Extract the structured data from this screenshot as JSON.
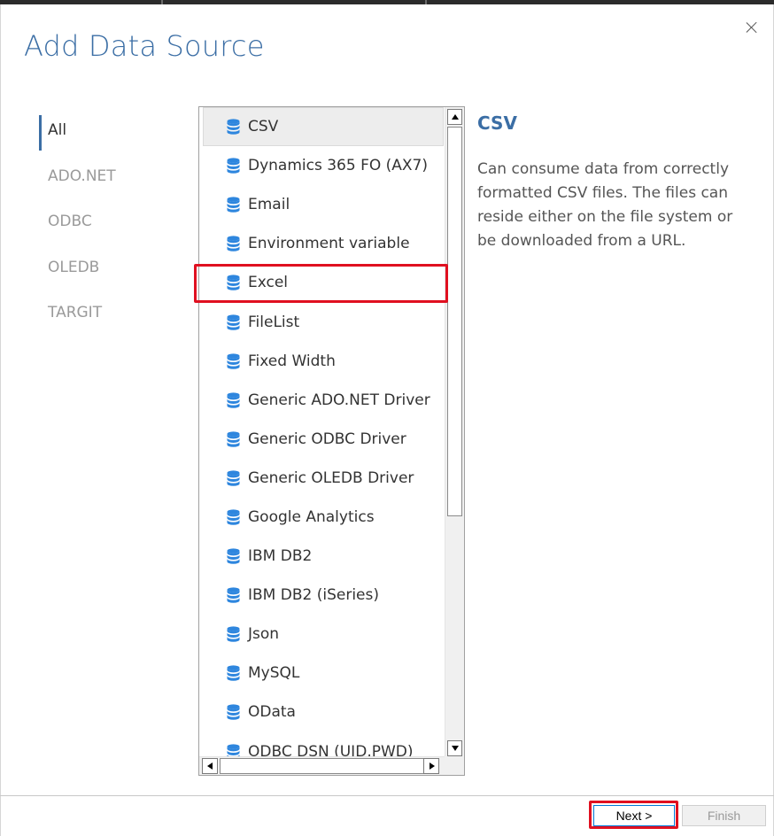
{
  "dialog": {
    "title": "Add Data Source",
    "close_icon": "close-icon"
  },
  "categories": [
    {
      "label": "All",
      "active": true
    },
    {
      "label": "ADO.NET",
      "active": false
    },
    {
      "label": "ODBC",
      "active": false
    },
    {
      "label": "OLEDB",
      "active": false
    },
    {
      "label": "TARGIT",
      "active": false
    }
  ],
  "sources": {
    "icon": "database-icon",
    "items": [
      {
        "label": "CSV",
        "selected": true
      },
      {
        "label": "Dynamics 365 FO (AX7)"
      },
      {
        "label": "Email"
      },
      {
        "label": "Environment variable"
      },
      {
        "label": "Excel",
        "highlighted": true
      },
      {
        "label": "FileList"
      },
      {
        "label": "Fixed Width"
      },
      {
        "label": "Generic ADO.NET Driver"
      },
      {
        "label": "Generic ODBC Driver"
      },
      {
        "label": "Generic OLEDB Driver"
      },
      {
        "label": "Google Analytics"
      },
      {
        "label": "IBM DB2"
      },
      {
        "label": "IBM DB2 (iSeries)"
      },
      {
        "label": "Json"
      },
      {
        "label": "MySQL"
      },
      {
        "label": "OData"
      },
      {
        "label": "ODBC DSN (UID,PWD)"
      }
    ]
  },
  "detail": {
    "title": "CSV",
    "description": "Can consume data from correctly formatted CSV files. The files can reside either on the file system or be downloaded from a URL."
  },
  "footer": {
    "next_label": "Next >",
    "finish_label": "Finish"
  },
  "colors": {
    "accent": "#3b6ea5",
    "highlight": "#e01020",
    "db_icon": "#2e86de"
  }
}
